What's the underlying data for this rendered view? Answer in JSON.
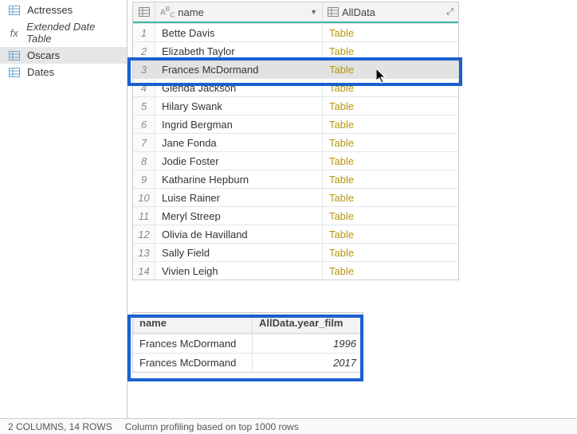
{
  "sidebar": {
    "items": [
      {
        "label": "Actresses"
      },
      {
        "label": "Extended Date Table"
      },
      {
        "label": "Oscars"
      },
      {
        "label": "Dates"
      }
    ]
  },
  "grid": {
    "name_header": "name",
    "alldata_header": "AllData",
    "rows": [
      {
        "n": "1",
        "name": "Bette Davis",
        "all": "Table"
      },
      {
        "n": "2",
        "name": "Elizabeth Taylor",
        "all": "Table"
      },
      {
        "n": "3",
        "name": "Frances McDormand",
        "all": "Table"
      },
      {
        "n": "4",
        "name": "Glenda Jackson",
        "all": "Table"
      },
      {
        "n": "5",
        "name": "Hilary Swank",
        "all": "Table"
      },
      {
        "n": "6",
        "name": "Ingrid Bergman",
        "all": "Table"
      },
      {
        "n": "7",
        "name": "Jane Fonda",
        "all": "Table"
      },
      {
        "n": "8",
        "name": "Jodie Foster",
        "all": "Table"
      },
      {
        "n": "9",
        "name": "Katharine Hepburn",
        "all": "Table"
      },
      {
        "n": "10",
        "name": "Luise Rainer",
        "all": "Table"
      },
      {
        "n": "11",
        "name": "Meryl Streep",
        "all": "Table"
      },
      {
        "n": "12",
        "name": "Olivia de Havilland",
        "all": "Table"
      },
      {
        "n": "13",
        "name": "Sally Field",
        "all": "Table"
      },
      {
        "n": "14",
        "name": "Vivien Leigh",
        "all": "Table"
      }
    ]
  },
  "preview": {
    "h1": "name",
    "h2": "AllData.year_film",
    "rows": [
      {
        "name": "Frances McDormand",
        "year": "1996"
      },
      {
        "name": "Frances McDormand",
        "year": "2017"
      }
    ]
  },
  "status": {
    "cols": "2 COLUMNS, 14 ROWS",
    "profile": "Column profiling based on top 1000 rows"
  }
}
